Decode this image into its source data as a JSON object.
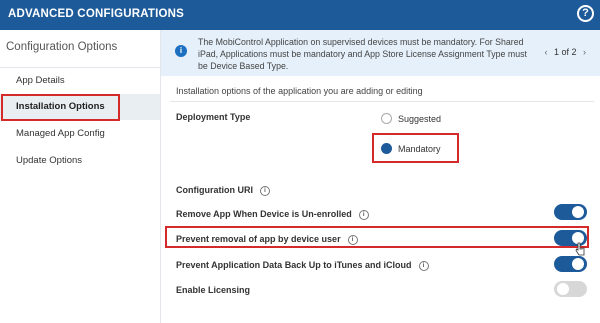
{
  "header": {
    "title": "ADVANCED CONFIGURATIONS",
    "help_icon": "help-circle-icon",
    "help_glyph": "?",
    "bg_color": "#1d5a99"
  },
  "sidebar": {
    "heading": "Configuration Options",
    "items": [
      {
        "label": "App Details",
        "active": false
      },
      {
        "label": "Installation Options",
        "active": true
      },
      {
        "label": "Managed App Config",
        "active": false
      },
      {
        "label": "Update Options",
        "active": false
      }
    ]
  },
  "notice": {
    "icon": "info-icon",
    "icon_glyph": "i",
    "text": "The MobiControl Application on supervised devices must be mandatory. For Shared iPad, Applications must be mandatory and App Store License Assignment Type must be Device Based Type.",
    "pager": {
      "prev": "‹",
      "label": "1 of 2",
      "next": "›"
    }
  },
  "main": {
    "intro": "Installation options of the application you are adding or editing",
    "deployment_type": {
      "label": "Deployment Type",
      "options": [
        {
          "label": "Suggested",
          "selected": false
        },
        {
          "label": "Mandatory",
          "selected": true
        }
      ]
    },
    "info_glyph": "i",
    "configuration_uri": {
      "label": "Configuration URI"
    },
    "settings": [
      {
        "label": "Remove App When Device is Un-enrolled",
        "on": true
      },
      {
        "label": "Prevent removal of app by device user",
        "on": true
      },
      {
        "label": "Prevent Application Data Back Up to iTunes and iCloud",
        "on": true
      },
      {
        "label": "Enable Licensing",
        "on": false
      }
    ]
  },
  "colors": {
    "accent": "#1d5a99",
    "highlight_border": "#d42a2a",
    "notice_bg": "#e5f0fa",
    "toggle_off": "#d7d7d7"
  }
}
